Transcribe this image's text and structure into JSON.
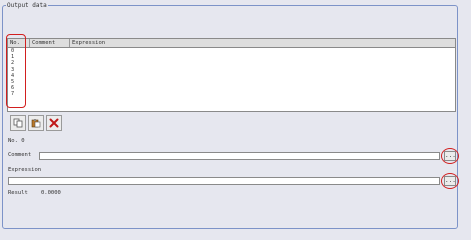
{
  "panel": {
    "title": "Output data"
  },
  "table": {
    "headers": [
      "No.",
      "Comment",
      "Expression"
    ],
    "rows": [
      "0",
      "1",
      "2",
      "3",
      "4",
      "5",
      "6",
      "7"
    ]
  },
  "toolbar": {
    "copy_icon": "copy-icon",
    "paste_icon": "paste-icon",
    "delete_icon": "delete-x-icon"
  },
  "detail": {
    "no_label": "No. 0",
    "comment_label": "Comment",
    "comment_value": "",
    "expression_label": "Expression",
    "expression_value": "",
    "ellipsis": "...",
    "result_label": "Result",
    "result_value": "0.0000"
  },
  "colors": {
    "highlight": "#d21f1f",
    "frame": "#7d93c8",
    "background": "#e6e7ef"
  }
}
